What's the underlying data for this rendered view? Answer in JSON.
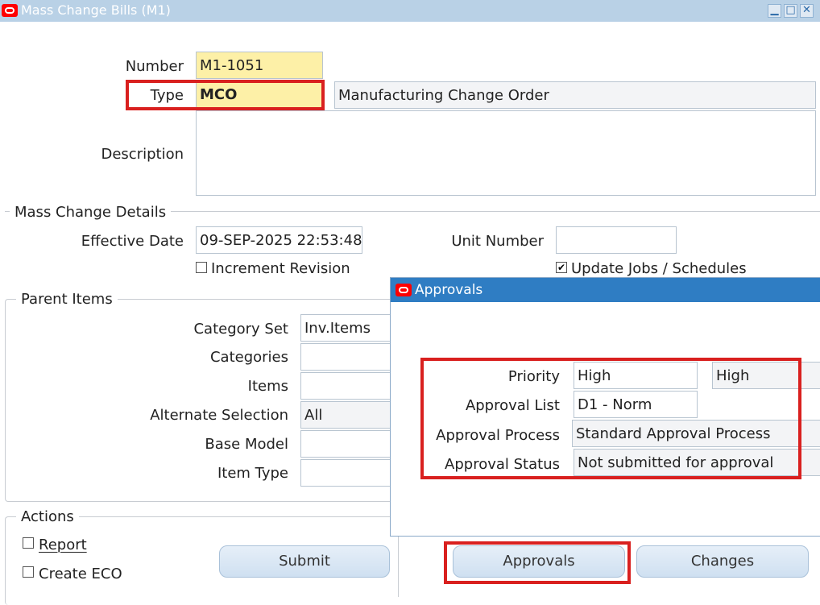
{
  "window": {
    "title": "Mass Change Bills (M1)",
    "controls": [
      "minimize-icon",
      "maximize-icon",
      "close-icon"
    ],
    "control_glyphs": {
      "minimize": "▁",
      "maximize": "□",
      "close": "✕"
    }
  },
  "header": {
    "number_label": "Number",
    "number_value": "M1-1051",
    "type_label": "Type",
    "type_value": "MCO",
    "type_description": "Manufacturing Change Order",
    "description_label": "Description",
    "description_value": ""
  },
  "mass_change_details": {
    "section_title": "Mass Change Details",
    "effective_date_label": "Effective Date",
    "effective_date_value": "09-SEP-2025 22:53:48",
    "unit_number_label": "Unit Number",
    "unit_number_value": "",
    "increment_revision_label": "Increment Revision",
    "increment_revision_checked": false,
    "update_jobs_label": "Update Jobs / Schedules",
    "update_jobs_checked": true
  },
  "parent_items": {
    "section_title": "Parent Items",
    "category_set_label": "Category Set",
    "category_set_value": "Inv.Items",
    "categories_label": "Categories",
    "items_label": "Items",
    "alternate_selection_label": "Alternate Selection",
    "alternate_selection_value": "All",
    "base_model_label": "Base Model",
    "item_type_label": "Item Type"
  },
  "actions": {
    "section_title": "Actions",
    "report_label": "Report",
    "create_eco_label": "Create ECO",
    "submit_label": "Submit",
    "approvals_label": "Approvals",
    "changes_label": "Changes"
  },
  "approvals_dialog": {
    "title": "Approvals",
    "priority_label": "Priority",
    "priority_code": "High",
    "priority_desc": "High",
    "approval_list_label": "Approval List",
    "approval_list_value": "D1 - Norm",
    "approval_process_label": "Approval Process",
    "approval_process_value": "Standard Approval Process",
    "approval_status_label": "Approval Status",
    "approval_status_value": "Not submitted for approval"
  },
  "colors": {
    "highlight_red": "#d9201f",
    "required_field": "#fdf0a7",
    "dialog_title": "#2f7dc3",
    "titlebar": "#b9d1e6"
  }
}
